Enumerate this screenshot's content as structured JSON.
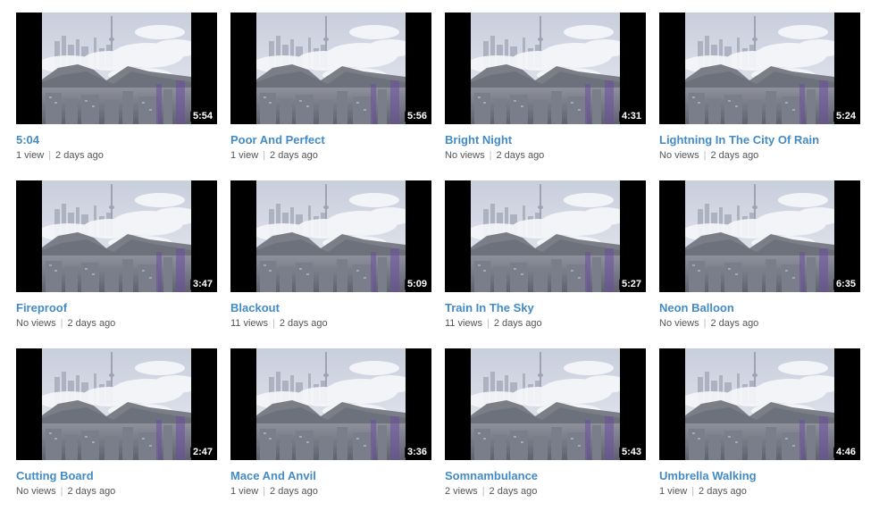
{
  "videos": [
    {
      "duration": "5:54",
      "title": "5:04",
      "views": "1 view",
      "age": "2 days ago"
    },
    {
      "duration": "5:56",
      "title": "Poor And Perfect",
      "views": "1 view",
      "age": "2 days ago"
    },
    {
      "duration": "4:31",
      "title": "Bright Night",
      "views": "No views",
      "age": "2 days ago"
    },
    {
      "duration": "5:24",
      "title": "Lightning In The City Of Rain",
      "views": "No views",
      "age": "2 days ago"
    },
    {
      "duration": "3:47",
      "title": "Fireproof",
      "views": "No views",
      "age": "2 days ago"
    },
    {
      "duration": "5:09",
      "title": "Blackout",
      "views": "11 views",
      "age": "2 days ago"
    },
    {
      "duration": "5:27",
      "title": "Train In The Sky",
      "views": "11 views",
      "age": "2 days ago"
    },
    {
      "duration": "6:35",
      "title": "Neon Balloon",
      "views": "No views",
      "age": "2 days ago"
    },
    {
      "duration": "2:47",
      "title": "Cutting Board",
      "views": "No views",
      "age": "2 days ago"
    },
    {
      "duration": "3:36",
      "title": "Mace And Anvil",
      "views": "1 view",
      "age": "2 days ago"
    },
    {
      "duration": "5:43",
      "title": "Somnambulance",
      "views": "2 views",
      "age": "2 days ago"
    },
    {
      "duration": "4:46",
      "title": "Umbrella Walking",
      "views": "1 view",
      "age": "2 days ago"
    }
  ],
  "separator": "|",
  "colors": {
    "title_link": "#438bc5",
    "meta_text": "#555555",
    "thumbnail_letterbox": "#000000",
    "duration_badge_bg": "#000000",
    "duration_badge_text": "#ffffff"
  }
}
